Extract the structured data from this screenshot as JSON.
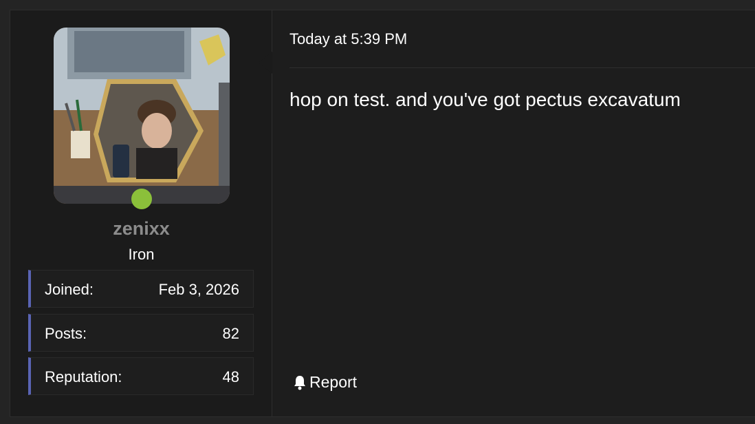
{
  "post": {
    "timestamp": "Today at 5:39 PM",
    "message": "hop on test. and you've got pectus excavatum",
    "report_label": "Report"
  },
  "user": {
    "username": "zenixx",
    "rank": "Iron",
    "online": true,
    "stats": [
      {
        "label": "Joined:",
        "value": "Feb 3, 2026"
      },
      {
        "label": "Posts:",
        "value": "82"
      },
      {
        "label": "Reputation:",
        "value": "48"
      }
    ]
  },
  "icons": {
    "report": "bell-icon",
    "status": "online-status-dot"
  },
  "colors": {
    "online": "#8bc03a",
    "stat_accent": "#5a64b4",
    "username": "#8c8c8c"
  }
}
